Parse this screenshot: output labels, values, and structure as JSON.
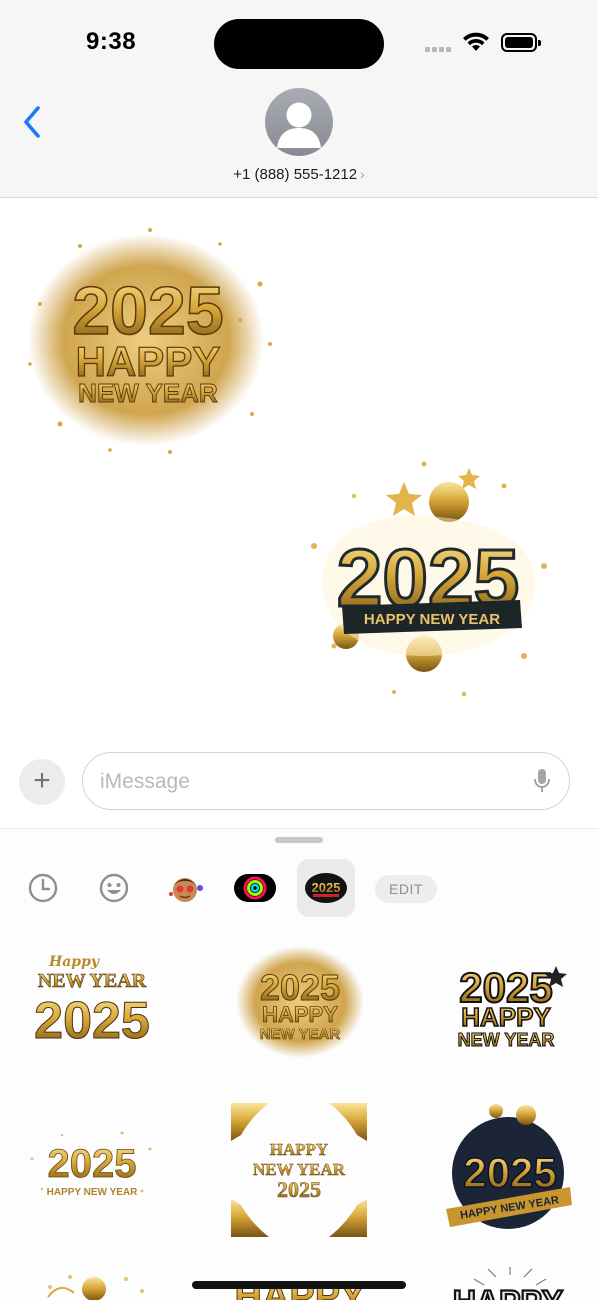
{
  "status_bar": {
    "time": "9:38"
  },
  "header": {
    "contact": "+1 (888) 555-1212",
    "chevron": "›"
  },
  "messages": [
    {
      "sender": "them",
      "sticker": {
        "top": "2025",
        "mid": "HAPPY",
        "bottom": "NEW YEAR"
      }
    },
    {
      "sender": "me",
      "sticker": {
        "year": "2025",
        "banner": "HAPPY NEW YEAR"
      }
    }
  ],
  "compose": {
    "plus": "+",
    "placeholder": "iMessage"
  },
  "tray": {
    "items": [
      "recents-icon",
      "emoji-icon",
      "memoji-app-icon",
      "fitness-app-icon",
      "2025-sticker-pack-icon"
    ],
    "pack_label": "2025",
    "edit_label": "EDIT"
  },
  "sticker_grid": [
    {
      "l1": "Happy",
      "l2": "NEW YEAR",
      "l3": "2025"
    },
    {
      "l1": "2025",
      "l2": "HAPPY",
      "l3": "NEW YEAR"
    },
    {
      "l1": "2025",
      "l2": "HAPPY",
      "l3": "NEW YEAR"
    },
    {
      "l1": "2025",
      "l2": "HAPPY NEW YEAR"
    },
    {
      "l1": "HAPPY",
      "l2": "NEW YEAR",
      "l3": "2025"
    },
    {
      "l1": "2025",
      "l2": "HAPPY NEW YEAR"
    },
    {
      "l1": "HAPPY"
    },
    {
      "l1": "HAPPY"
    }
  ],
  "colors": {
    "accent": "#1a7cf5",
    "gold": "#d4a63a",
    "gold_dark": "#7a5412"
  }
}
